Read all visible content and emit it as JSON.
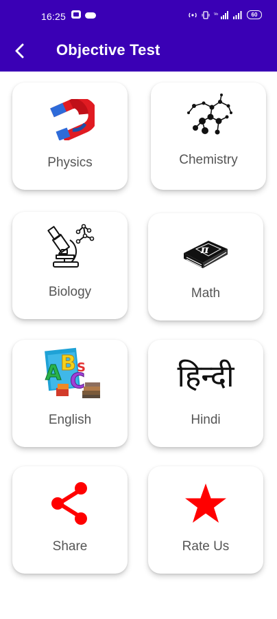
{
  "status": {
    "time": "16:25",
    "signal_text": "VoLTE",
    "battery": "60"
  },
  "toolbar": {
    "title": "Objective Test",
    "back_icon": "back-arrow-icon"
  },
  "colors": {
    "appbar": "#3a00b5",
    "label": "#555555",
    "share": "#ff0000",
    "star": "#ff0000"
  },
  "cards": [
    {
      "label": "Physics",
      "icon": "magnet-icon"
    },
    {
      "label": "Chemistry",
      "icon": "molecule-icon"
    },
    {
      "label": "Biology",
      "icon": "microscope-icon"
    },
    {
      "label": "Math",
      "icon": "pi-book-icon"
    },
    {
      "label": "English",
      "icon": "abc-books-icon"
    },
    {
      "label": "Hindi",
      "icon": "hindi-text-icon",
      "glyph": "हिन्दी"
    },
    {
      "label": "Share",
      "icon": "share-icon"
    },
    {
      "label": "Rate Us",
      "icon": "star-icon"
    }
  ]
}
